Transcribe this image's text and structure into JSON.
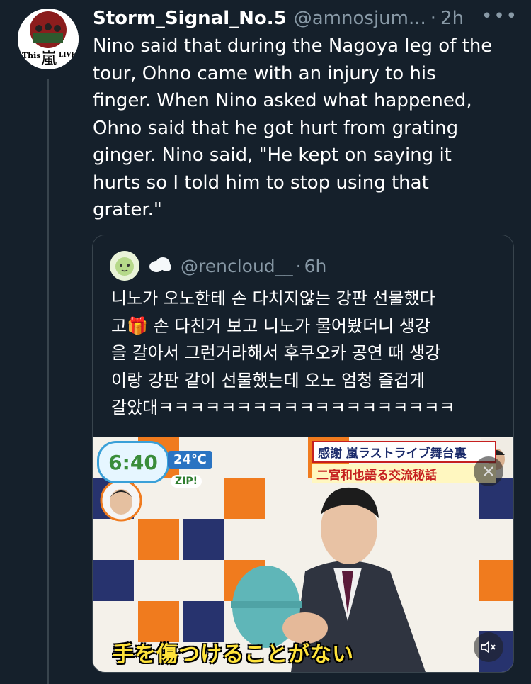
{
  "tweet": {
    "display_name": "Storm_Signal_No.5",
    "handle": "@amnosjum...",
    "separator": "·",
    "time": "2h",
    "more_icon": "more-horizontal-icon",
    "avatar_text": "This is 嵐 LIVE",
    "text": "Nino said that during the Nagoya leg of the\ntour, Ohno came with an injury to his\nfinger. When Nino asked what happened,\nOhno said that he got hurt from grating\nginger. Nino said, \"He kept on saying it\nhurts so I told him to stop using that\ngrater.\""
  },
  "quote": {
    "name_icon": "cloud-emoji-icon",
    "handle": "@rencloud__",
    "separator": "·",
    "time": "6h",
    "text": "니노가 오노한테 손 다치지않는 강판 선물했다\n고🎁 손 다친거 보고 니노가 물어봤더니 생강\n을 갈아서 그런거라해서 후쿠오카 공연 때 생강\n이랑 강판 같이 선물했는데 오노 엄청 즐겁게\n갈았대ㅋㅋㅋㅋㅋㅋㅋㅋㅋㅋㅋㅋㅋㅋㅋㅋㅋㅋㅋ",
    "media": {
      "time_overlay": "6:40",
      "temp_overlay": "24℃",
      "zip_label": "ZIP!",
      "banner_line1": "感謝 嵐ラストライブ舞台裏",
      "banner_line2": "二宮和也語る交流秘話",
      "caption": "手を傷つけることがない",
      "mute_icon": "speaker-muted-icon",
      "top_right_icon": "close-icon"
    }
  },
  "colors": {
    "background": "#15202b",
    "border": "#38444d",
    "muted_text": "#8899a6",
    "text": "#ffffff"
  }
}
